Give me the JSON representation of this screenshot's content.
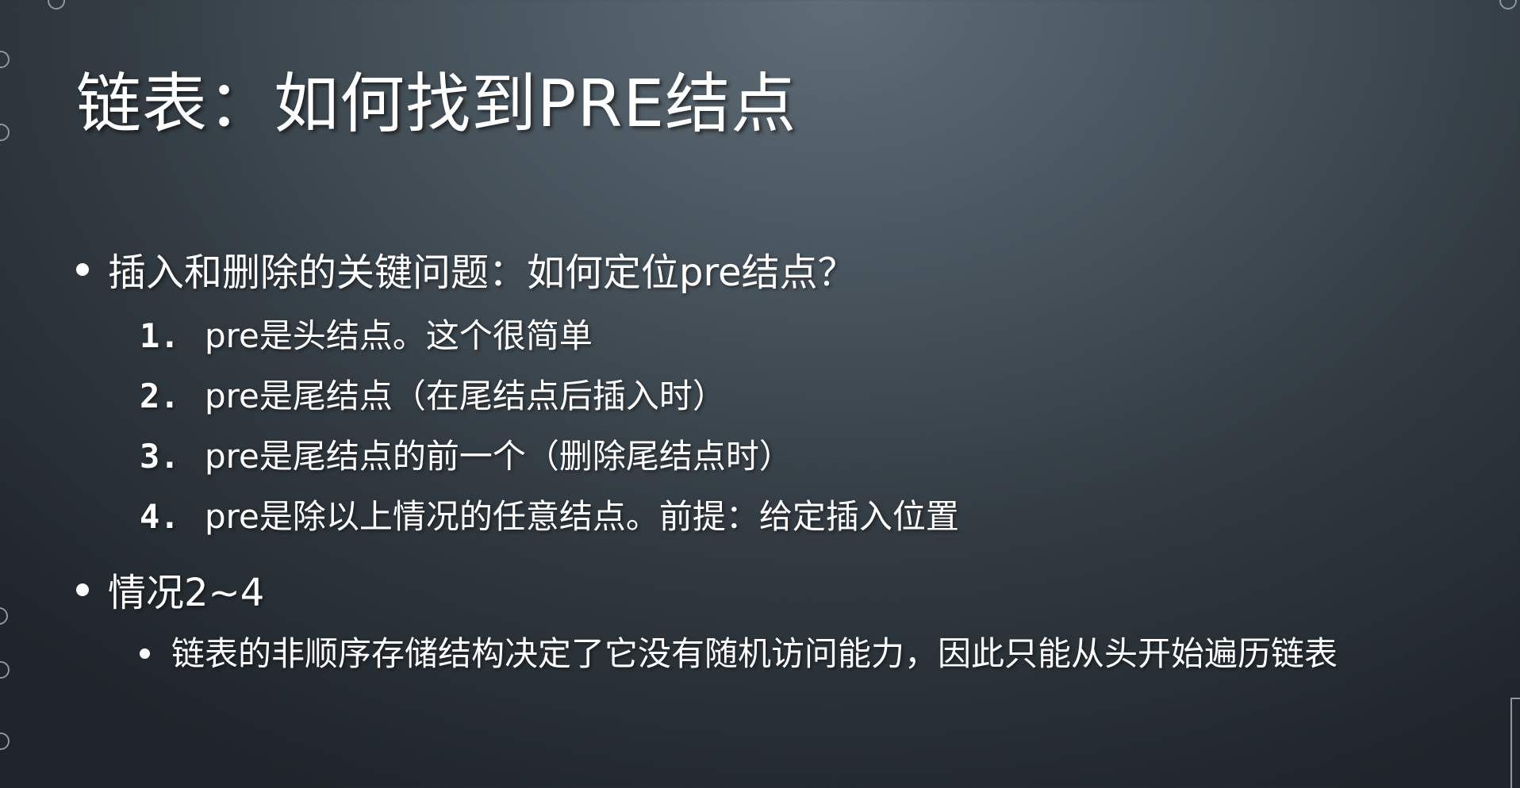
{
  "slide": {
    "title": "链表：如何找到PRE结点",
    "bullets": [
      {
        "text": "插入和删除的关键问题：如何定位pre结点？",
        "numbered_items": [
          {
            "num": "1.",
            "text": "pre是头结点。这个很简单"
          },
          {
            "num": "2.",
            "text": "pre是尾结点（在尾结点后插入时）"
          },
          {
            "num": "3.",
            "text": "pre是尾结点的前一个（删除尾结点时）"
          },
          {
            "num": "4.",
            "text": "pre是除以上情况的任意结点。前提：给定插入位置"
          }
        ]
      },
      {
        "text": "情况2~4",
        "sub_bullets": [
          {
            "text": "链表的非顺序存储结构决定了它没有随机访问能力，因此只能从头开始遍历链表"
          }
        ]
      }
    ]
  },
  "colors": {
    "text": "#ffffff",
    "background_light": "#5f6d77",
    "background_dark": "#1f252a",
    "decoration": "#8c979f"
  }
}
